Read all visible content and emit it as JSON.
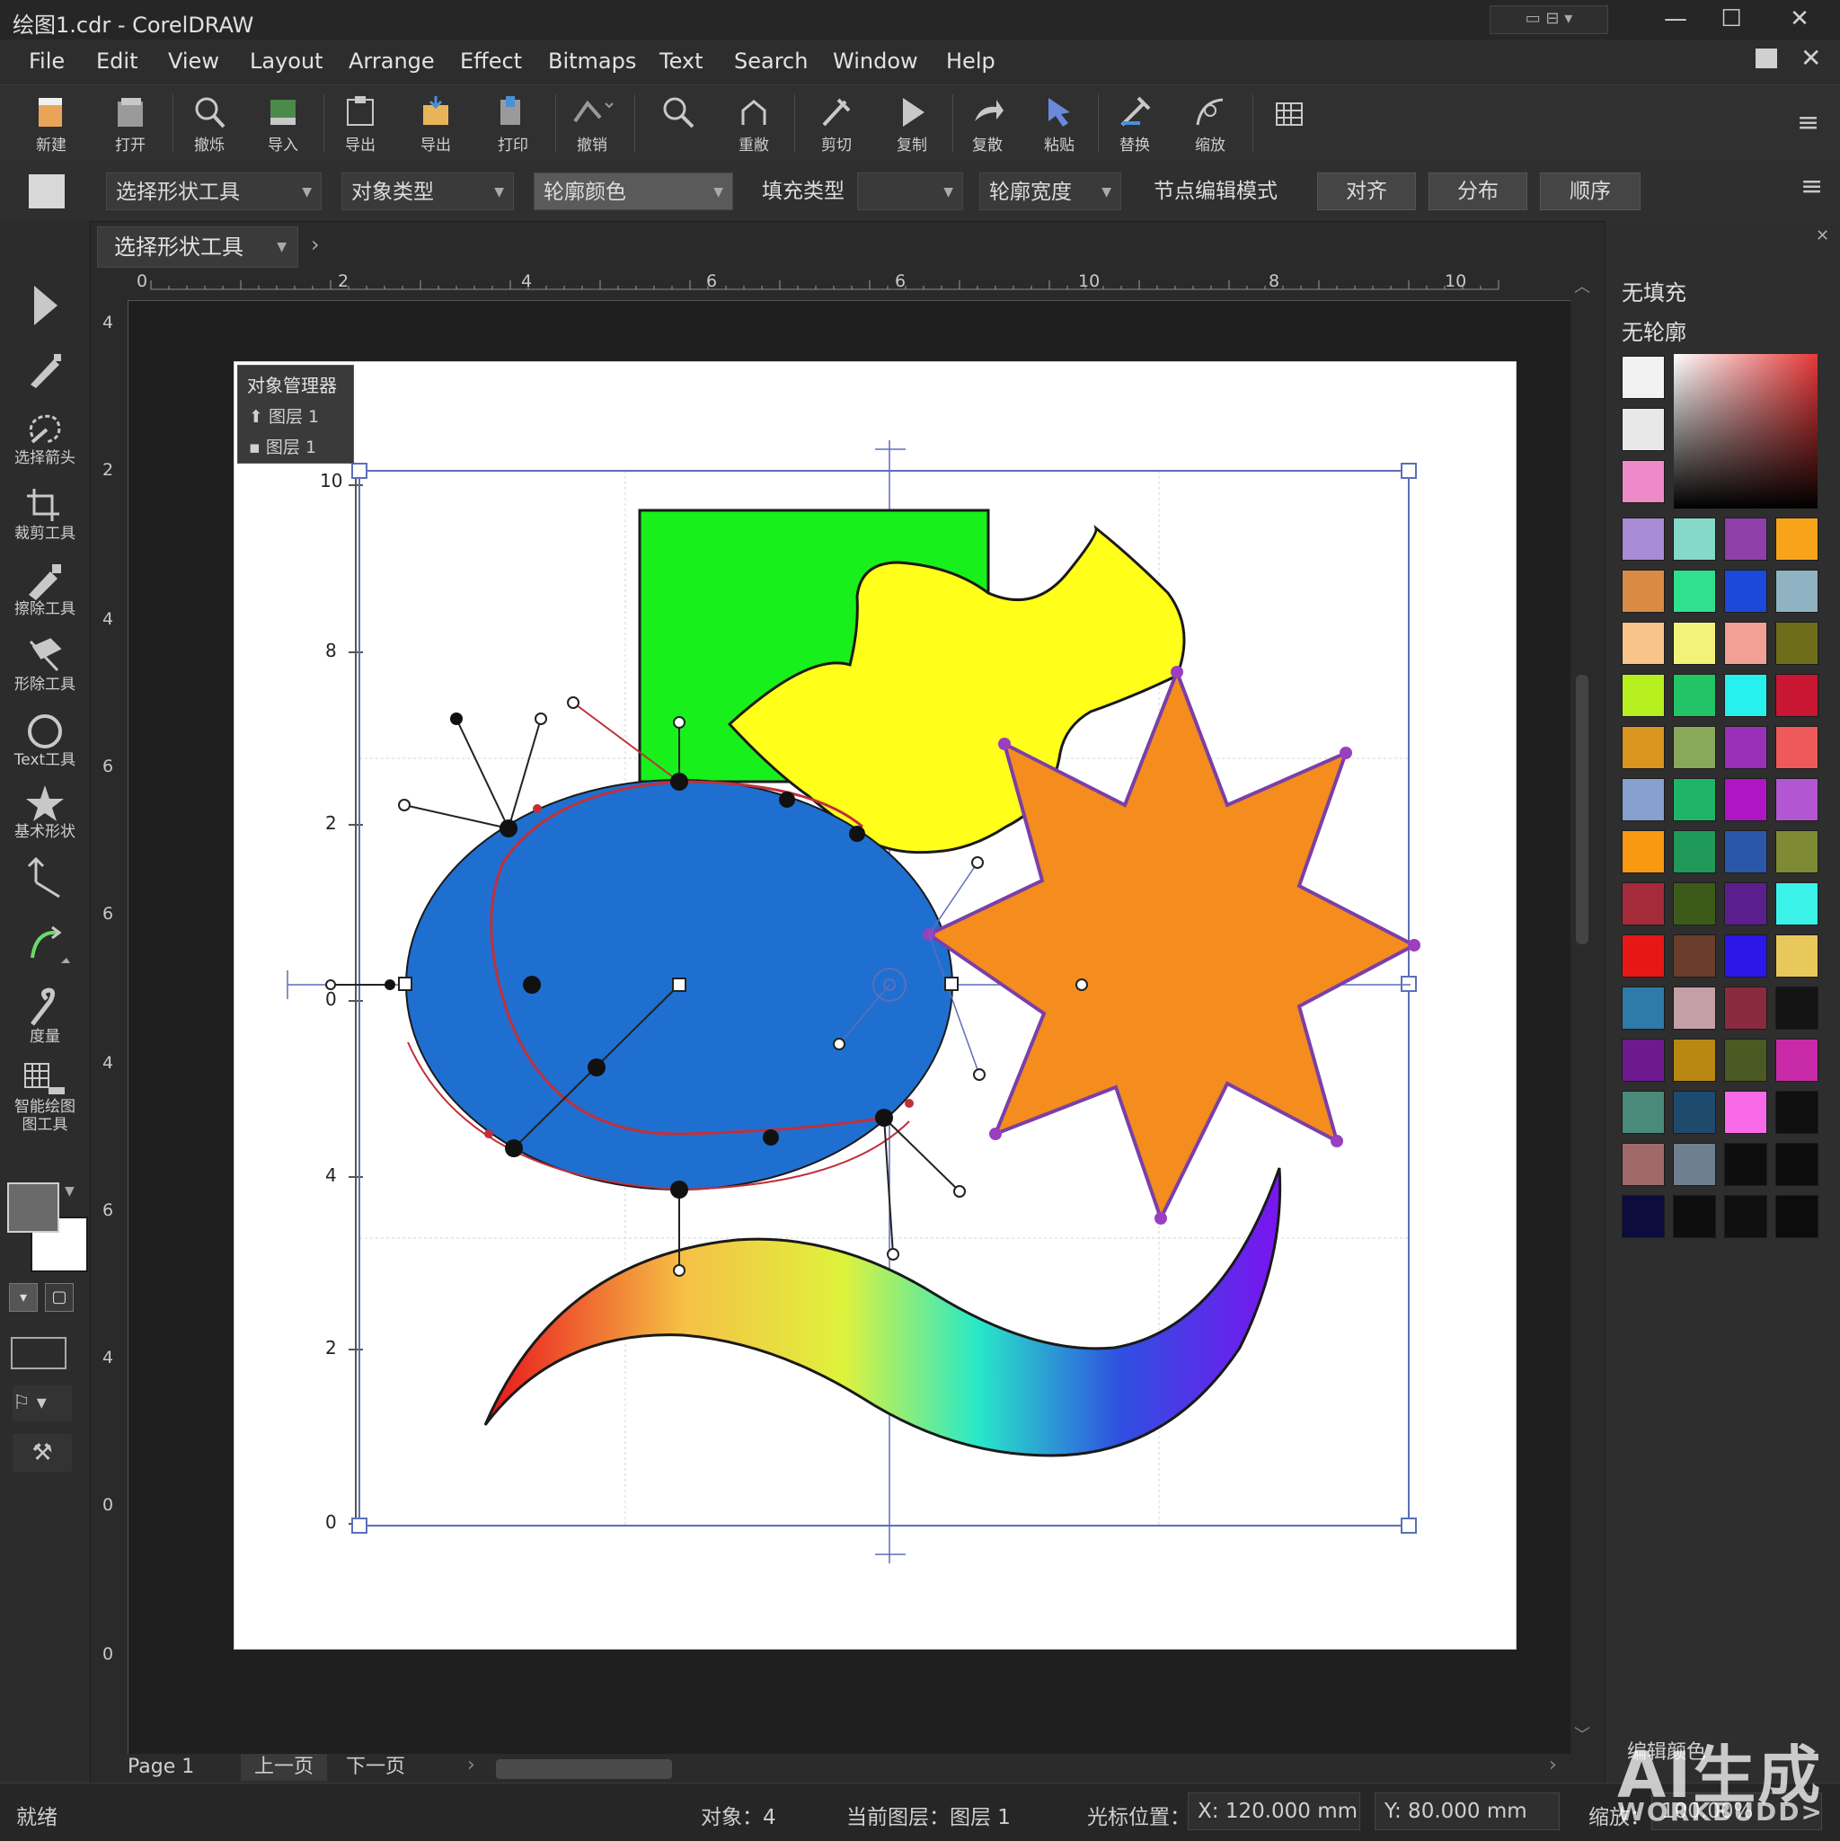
{
  "window": {
    "title": "绘图1.cdr - CorelDRAW"
  },
  "menu": [
    "File",
    "Edit",
    "View",
    "Layout",
    "Arrange",
    "Effect",
    "Bitmaps",
    "Text",
    "Search",
    "Window",
    "Help"
  ],
  "toolbar": [
    {
      "label": "新建",
      "icon": "new-document-icon"
    },
    {
      "label": "打开",
      "icon": "open-icon"
    },
    {
      "label": "撤烁",
      "icon": "zoom-icon"
    },
    {
      "label": "导入",
      "icon": "import-icon"
    },
    {
      "label": "导出",
      "icon": "export-icon"
    },
    {
      "label": "导出",
      "icon": "export-folder-icon"
    },
    {
      "label": "打印",
      "icon": "print-icon"
    },
    {
      "label": "撤销",
      "icon": "undo-icon"
    },
    {
      "label": "重敝",
      "icon": "search-icon"
    },
    {
      "label": "剪切",
      "icon": "redo-icon"
    },
    {
      "label": "复制",
      "icon": "cut-icon"
    },
    {
      "label": "复散",
      "icon": "play-icon"
    },
    {
      "label": "粘贴",
      "icon": "forward-icon"
    },
    {
      "label": "替换",
      "icon": "paste-icon"
    },
    {
      "label": "缩放",
      "icon": "replace-icon"
    },
    {
      "label": "",
      "icon": "zoom-curve-icon"
    },
    {
      "label": "",
      "icon": "grid-icon"
    }
  ],
  "propbar": {
    "tool_select": "选择形状工具",
    "object_type": "对象类型",
    "outline_color": "轮廓颜色",
    "fill_type": "填充类型",
    "outline_width": "轮廓宽度",
    "node_mode": "节点编辑模式",
    "align": "对齐",
    "distribute": "分布",
    "order": "顺序"
  },
  "doctab": {
    "label": "选择形状工具"
  },
  "toolbox": [
    {
      "label": "",
      "icon": "pick-arrow-icon"
    },
    {
      "label": "",
      "icon": "pen-icon"
    },
    {
      "label": "选择箭头",
      "icon": "lasso-icon"
    },
    {
      "label": "裁剪工具",
      "icon": "crop-icon"
    },
    {
      "label": "擦除工具",
      "icon": "eraser-icon"
    },
    {
      "label": "形除工具",
      "icon": "shape-knife-icon"
    },
    {
      "label": "Text工具",
      "icon": "ellipse-tool-icon"
    },
    {
      "label": "基术形状",
      "icon": "star-icon"
    },
    {
      "label": "",
      "icon": "dimension-icon"
    },
    {
      "label": "",
      "icon": "curve-icon"
    },
    {
      "label": "度量",
      "icon": "hook-icon"
    },
    {
      "label": "智能绘图图工具",
      "icon": "smart-drawing-icon"
    }
  ],
  "object_manager": {
    "title": "对象管理器",
    "layers": [
      "图层 1",
      "图层 1"
    ]
  },
  "rulers": {
    "horizontal": [
      "0",
      "2",
      "4",
      "6",
      "6",
      "10",
      "8",
      "10"
    ],
    "vertical": [
      "4",
      "2",
      "4",
      "6",
      "6",
      "4",
      "6",
      "4",
      "0",
      "0"
    ],
    "inner": [
      "10",
      "8",
      "2",
      "0",
      "4",
      "2",
      "0"
    ]
  },
  "right_panel": {
    "no_fill": "无填充",
    "no_outline": "无轮廓",
    "edit_color": "编辑颜色",
    "palette": [
      "#a78bd4",
      "#86d8c8",
      "#8e3fa8",
      "#f7a41b",
      "#d98a45",
      "#2fe08e",
      "#1c49d9",
      "#8fb3c2",
      "#f9c48a",
      "#f2f27a",
      "#f2a096",
      "#6e6e1a",
      "#b5f01e",
      "#22c466",
      "#27f0ef",
      "#c81633",
      "#d9951e",
      "#8aa85a",
      "#9a2fb8",
      "#ee5a5a",
      "#86a0cf",
      "#1fb568",
      "#b015c4",
      "#b256d2",
      "#f79a12",
      "#1f9a5a",
      "#2b57a8",
      "#7e8a34",
      "#a52a3a",
      "#3e5a1a",
      "#5b1f8e",
      "#3af2e8",
      "#e81717",
      "#6a3e2a",
      "#2a17e8",
      "#e8c85a",
      "#2e7aa8",
      "#c4a0a6",
      "#8a2a3e",
      "#141414",
      "#6e1a8e",
      "#b88812",
      "#4a5a22",
      "#c82aa8",
      "#4a8a7a",
      "#1e4a6e",
      "#f86ae8",
      "#101010",
      "#a06a6a",
      "#6e8090",
      "#0e0e0e",
      "#0c0c0c",
      "#0c0c3e",
      "#0e0e0e",
      "#101010",
      "#0c0c0c"
    ]
  },
  "pagebar": {
    "page": "Page 1",
    "prev": "上一页",
    "next": "下一页"
  },
  "status": {
    "ready": "就绪",
    "objects": "对象：4",
    "layer": "当前图层：图层 1",
    "cursor_label": "光标位置：",
    "x": "X: 120.000 mm",
    "y": "Y: 80.000 mm",
    "zoom_label": "缩放：",
    "zoom_value": "100.00%"
  },
  "watermark": {
    "main": "AI生成",
    "sub": "WORKBUDD>"
  },
  "colors": {
    "accent": "#5b6fb8",
    "ellipse": "#1f6fd1",
    "rect": "#18f01c",
    "blob": "#ffff1a",
    "star": "#f48c1e",
    "star_outline": "#7a3fa8"
  }
}
